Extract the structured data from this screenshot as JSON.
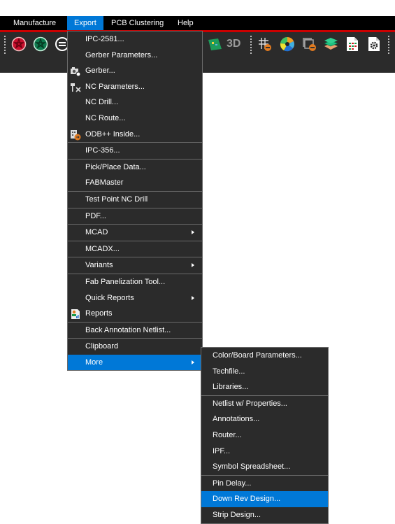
{
  "menubar": {
    "items": [
      {
        "label": "Manufacture"
      },
      {
        "label": "Export",
        "active": true
      },
      {
        "label": "PCB Clustering"
      },
      {
        "label": "Help"
      }
    ]
  },
  "toolbar": {
    "icons": [
      "drc-red-icon",
      "drc-green-icon",
      "circle-lines-icon",
      "board-view-icon",
      "3d-view-icon",
      "grid-toggle-icon",
      "color-wheel-icon",
      "window-toggle-icon",
      "layers-icon",
      "spreadsheet-report-icon",
      "settings-file-icon"
    ],
    "three_d_label": "3D"
  },
  "export_menu": {
    "items": [
      {
        "label": "IPC-2581..."
      },
      {
        "label": "Gerber Parameters..."
      },
      {
        "label": "Gerber...",
        "icon": "camera-gear-icon"
      },
      {
        "label": "NC Parameters...",
        "icon": "drill-tools-icon"
      },
      {
        "label": "NC Drill..."
      },
      {
        "label": "NC Route..."
      },
      {
        "label": "ODB++ Inside...",
        "icon": "odb-export-icon"
      },
      {
        "label": "IPC-356..."
      },
      {
        "label": "Pick/Place Data..."
      },
      {
        "label": "FABMaster"
      },
      {
        "label": "Test Point NC Drill"
      },
      {
        "label": "PDF..."
      },
      {
        "label": "MCAD",
        "submenu": true
      },
      {
        "label": "MCADX..."
      },
      {
        "label": "Variants",
        "submenu": true
      },
      {
        "label": "Fab Panelization Tool..."
      },
      {
        "label": "Quick Reports",
        "submenu": true
      },
      {
        "label": "Reports",
        "icon": "reports-icon"
      },
      {
        "label": "Back Annotation Netlist..."
      },
      {
        "label": "Clipboard"
      },
      {
        "label": "More",
        "submenu": true,
        "highlighted": true
      }
    ]
  },
  "more_menu": {
    "items": [
      {
        "label": "Color/Board Parameters..."
      },
      {
        "label": "Techfile..."
      },
      {
        "label": "Libraries..."
      },
      {
        "label": "Netlist w/ Properties..."
      },
      {
        "label": "Annotations..."
      },
      {
        "label": "Router..."
      },
      {
        "label": "IPF..."
      },
      {
        "label": "Symbol Spreadsheet..."
      },
      {
        "label": "Pin Delay..."
      },
      {
        "label": "Down Rev Design...",
        "highlighted": true
      },
      {
        "label": "Strip Design..."
      }
    ]
  },
  "colors": {
    "menubar_bg": "#000000",
    "accent_line": "#cc0000",
    "highlight": "#0078d7",
    "menu_bg": "#2b2b2b",
    "menu_border": "#6a6a6a"
  }
}
